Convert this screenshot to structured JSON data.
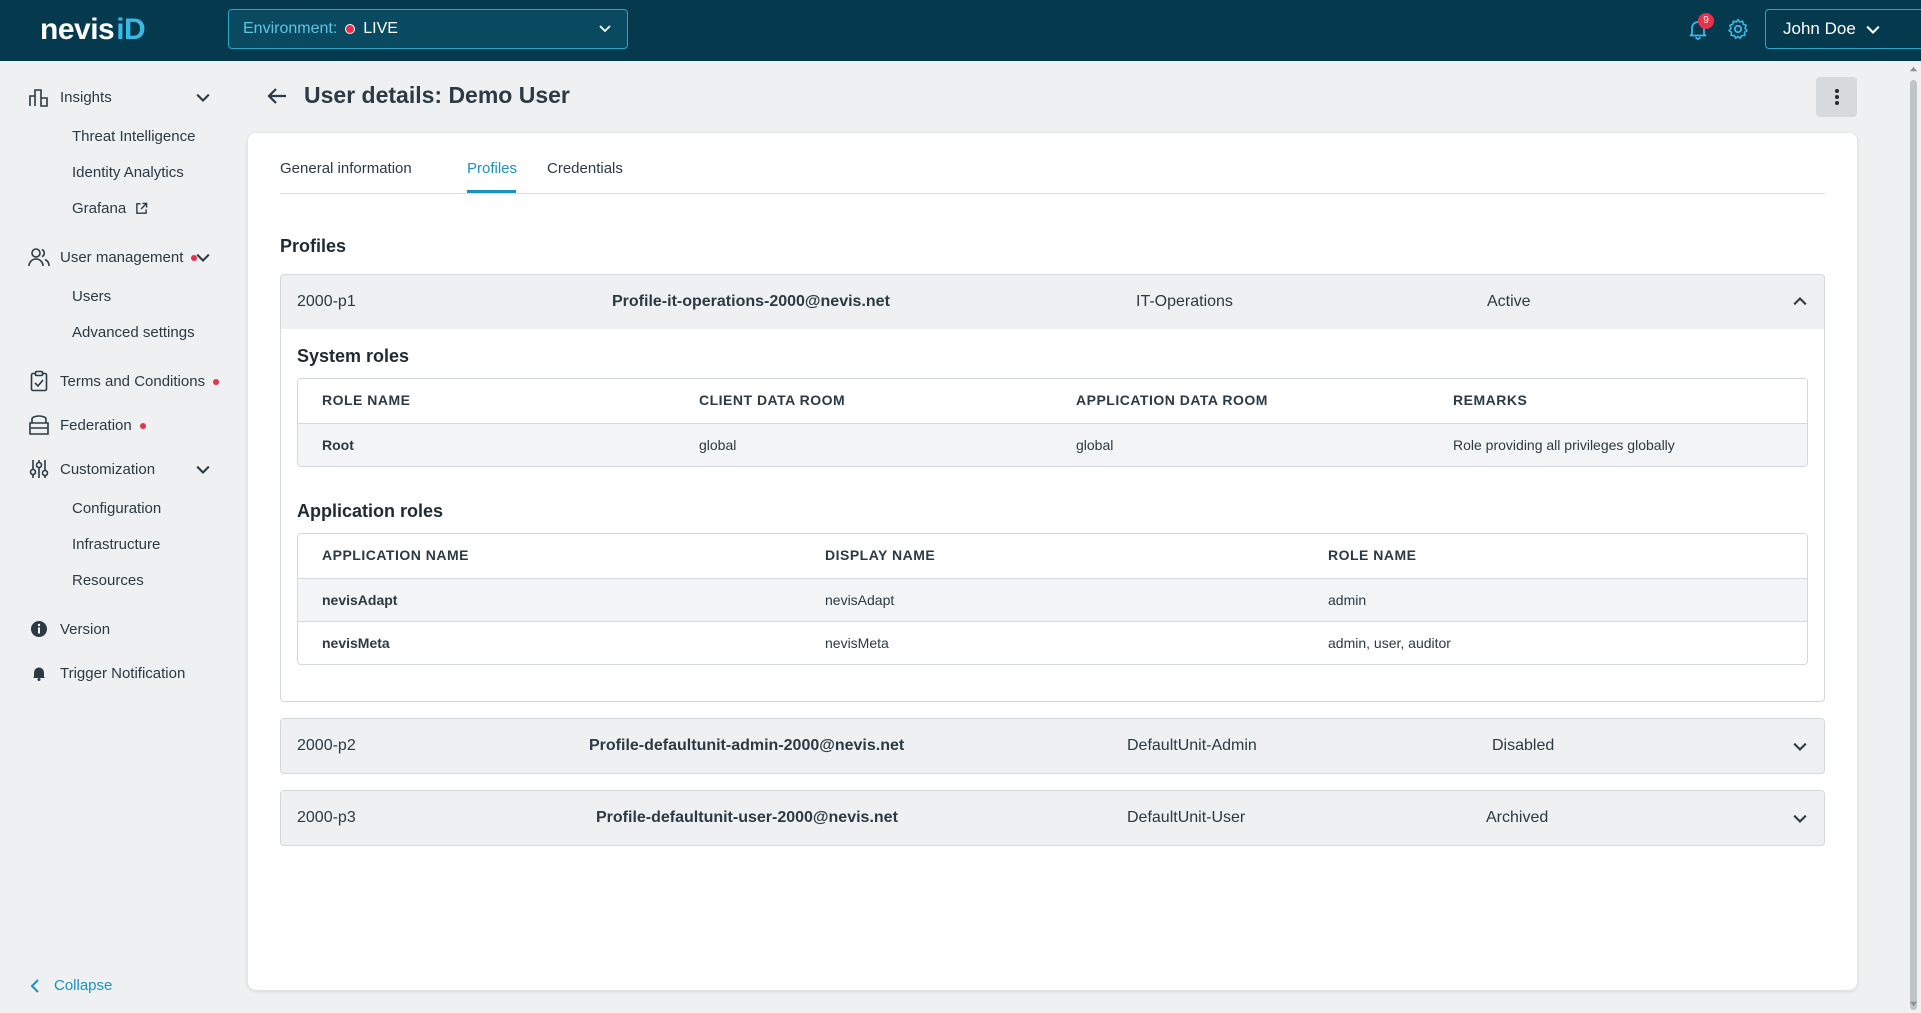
{
  "header": {
    "logo_text": "nevis",
    "logo_accent": "iD",
    "environment_label": "Environment:",
    "environment_value": "LIVE",
    "notification_count": "9",
    "user_name": "John Doe"
  },
  "sidebar": {
    "insights": {
      "label": "Insights",
      "items": [
        "Threat Intelligence",
        "Identity Analytics",
        "Grafana"
      ]
    },
    "user_management": {
      "label": "User management",
      "items": [
        "Users",
        "Advanced settings"
      ]
    },
    "terms": {
      "label": "Terms and Conditions"
    },
    "federation": {
      "label": "Federation"
    },
    "customization": {
      "label": "Customization",
      "items": [
        "Configuration",
        "Infrastructure",
        "Resources"
      ]
    },
    "version": {
      "label": "Version"
    },
    "trigger": {
      "label": "Trigger Notification"
    },
    "collapse_label": "Collapse"
  },
  "page": {
    "title": "User details: Demo User",
    "tabs": [
      "General information",
      "Profiles",
      "Credentials"
    ],
    "active_tab": "Profiles",
    "section_title": "Profiles"
  },
  "profiles": [
    {
      "id": "2000-p1",
      "email": "Profile-it-operations-2000@nevis.net",
      "unit": "IT-Operations",
      "status": "Active",
      "expanded": true,
      "system_roles_title": "System roles",
      "system_roles_headers": [
        "ROLE NAME",
        "CLIENT DATA ROOM",
        "APPLICATION DATA ROOM",
        "REMARKS"
      ],
      "system_roles": [
        {
          "role_name": "Root",
          "client_data_room": "global",
          "application_data_room": "global",
          "remarks": "Role providing all privileges globally"
        }
      ],
      "application_roles_title": "Application roles",
      "application_roles_headers": [
        "APPLICATION NAME",
        "DISPLAY NAME",
        "ROLE NAME"
      ],
      "application_roles": [
        {
          "application_name": "nevisAdapt",
          "display_name": "nevisAdapt",
          "role_name": "admin"
        },
        {
          "application_name": "nevisMeta",
          "display_name": "nevisMeta",
          "role_name": "admin, user, auditor"
        }
      ]
    },
    {
      "id": "2000-p2",
      "email": "Profile-defaultunit-admin-2000@nevis.net",
      "unit": "DefaultUnit-Admin",
      "status": "Disabled",
      "expanded": false
    },
    {
      "id": "2000-p3",
      "email": "Profile-defaultunit-user-2000@nevis.net",
      "unit": "DefaultUnit-User",
      "status": "Archived",
      "expanded": false
    }
  ],
  "colors": {
    "topbar": "#053a4e",
    "accent": "#1a93bd",
    "alert": "#e8304a",
    "background": "#eef0f1"
  }
}
